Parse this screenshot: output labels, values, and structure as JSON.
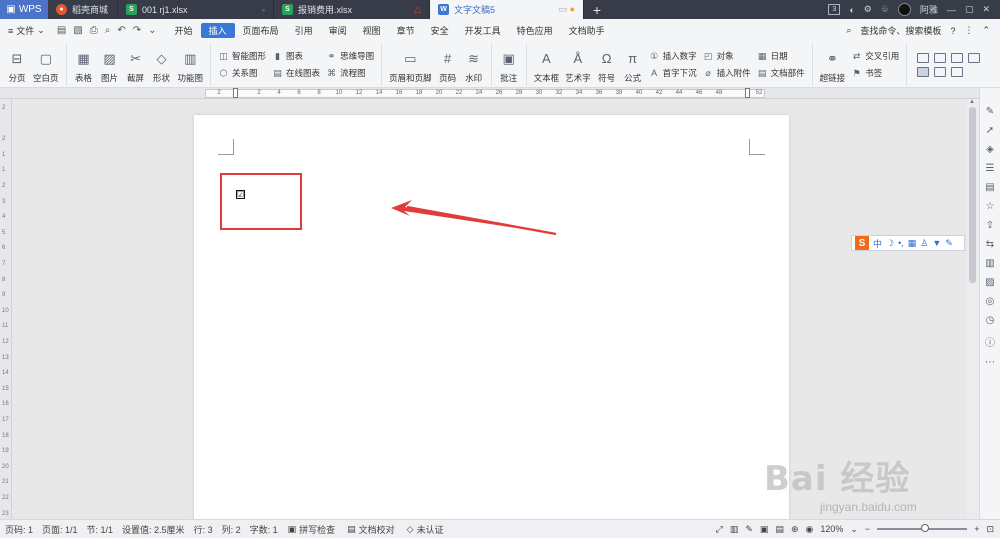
{
  "tabbar": {
    "app_name": "WPS",
    "tabs": [
      {
        "label": "稻壳商城",
        "color": "#e8552b",
        "icon": "fire-icon"
      },
      {
        "label": "001 rj1.xlsx",
        "color": "#2aa35a",
        "icon": "sheet-icon"
      },
      {
        "label": "报销费用.xlsx",
        "color": "#2aa35a",
        "icon": "sheet-icon"
      },
      {
        "label": "文字文稿5",
        "color": "#3b78d6",
        "icon": "doc-icon"
      }
    ],
    "badge": "3",
    "user": "阿雅"
  },
  "menubar": {
    "file_label": "文件",
    "items": [
      "开始",
      "插入",
      "页面布局",
      "引用",
      "审阅",
      "视图",
      "章节",
      "安全",
      "开发工具",
      "特色应用",
      "文档助手"
    ],
    "active": "插入",
    "search_label": "查找命令、搜索模板"
  },
  "ribbon": {
    "pages": [
      "分页",
      "空白页"
    ],
    "insert_big": [
      "表格",
      "图片",
      "截屏",
      "形状",
      "功能图"
    ],
    "graphics_col1": [
      "智能图形",
      "关系图"
    ],
    "graphics_col2": [
      "图表",
      "在线图表"
    ],
    "graphics_col3": [
      "思维导图",
      "流程图"
    ],
    "header_big": [
      "页眉和页脚",
      "页码",
      "水印"
    ],
    "comment_big": "批注",
    "text_big": [
      "文本框",
      "艺术字",
      "符号",
      "公式"
    ],
    "text_col1": [
      "插入数字",
      "首字下沉"
    ],
    "text_col2": [
      "对象",
      "插入附件"
    ],
    "text_col3": [
      "日期",
      "文档部件"
    ],
    "link_big": "超链接",
    "link_col": [
      "交叉引用",
      "书签"
    ]
  },
  "ruler": {
    "labels": [
      "2",
      "",
      "2",
      "4",
      "6",
      "8",
      "10",
      "12",
      "14",
      "16",
      "18",
      "20",
      "22",
      "24",
      "26",
      "28",
      "30",
      "32",
      "34",
      "36",
      "38",
      "40",
      "42",
      "44",
      "46",
      "48",
      "",
      "52"
    ]
  },
  "vruler": {
    "labels": [
      "2",
      "",
      "2",
      "1",
      "1",
      "2",
      "3",
      "4",
      "5",
      "6",
      "7",
      "8",
      "9",
      "10",
      "11",
      "12",
      "13",
      "14",
      "15",
      "16",
      "17",
      "18",
      "19",
      "20",
      "21",
      "22",
      "23"
    ]
  },
  "document": {
    "checkbox_glyph": "☑"
  },
  "ime": {
    "logo": "S",
    "mode": "中"
  },
  "watermark": {
    "main": "Bai 经验",
    "sub": "jingyan.baidu.com"
  },
  "statusbar": {
    "items": [
      "页码: 1",
      "页面: 1/1",
      "节: 1/1",
      "设置值: 2.5厘米",
      "行: 3",
      "列: 2",
      "字数: 1"
    ],
    "spellcheck": "拼写检查",
    "proofread": "文档校对",
    "certify": "未认证",
    "zoom": "120%"
  }
}
